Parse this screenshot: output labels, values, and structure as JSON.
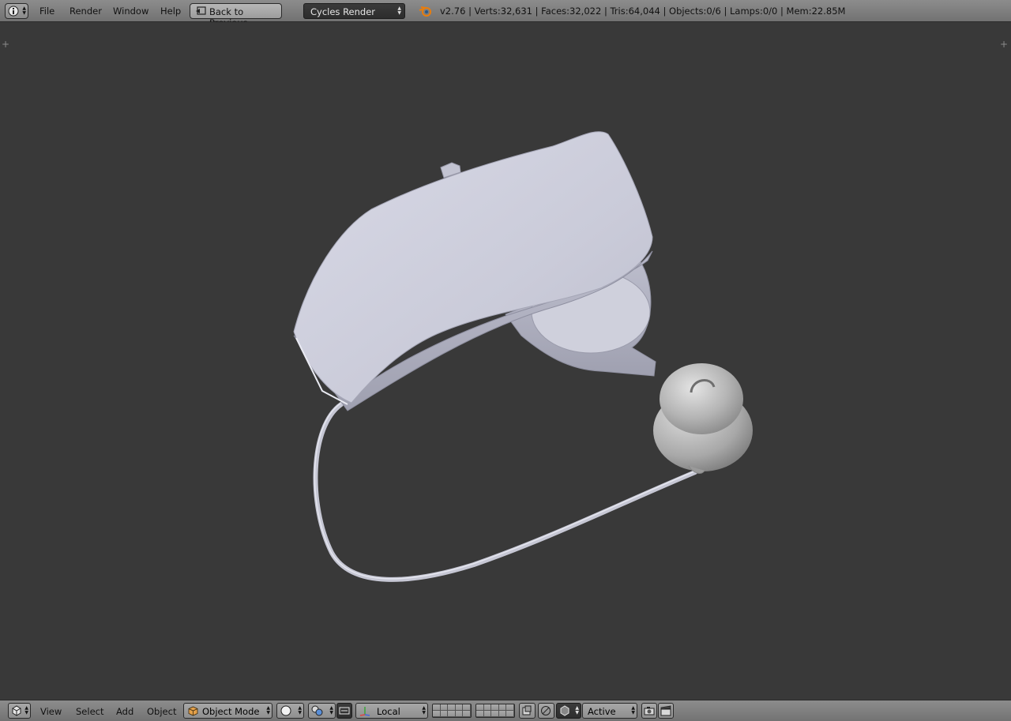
{
  "top_header": {
    "editor_type_icon": "info-icon",
    "menus": [
      "File",
      "Render",
      "Window",
      "Help"
    ],
    "back_button_label": "Back to Previous",
    "back_button_icon": "screen-back-icon",
    "render_engine": "Cycles Render",
    "logo_icon": "blender-logo-icon",
    "stats": "v2.76 | Verts:32,631 | Faces:32,022 | Tris:64,044 | Objects:0/6 | Lamps:0/0 | Mem:22.85M"
  },
  "viewport": {
    "background": "#393939",
    "model_color": "#c9cad8",
    "earbud_color": "#b5b5b5"
  },
  "bottom_header": {
    "editor_type_icon": "3d-view-icon",
    "menus": [
      "View",
      "Select",
      "Add",
      "Object"
    ],
    "mode": "Object Mode",
    "mode_icon": "cube-icon",
    "shading_icon": "solid-sphere-icon",
    "pivot_icon": "pivot-icon",
    "manipulator_icon": "manipulator-icon",
    "orientation_icon": "transform-axes-icon",
    "orientation": "Local",
    "layers_icon": "layers-icon",
    "snap_icon": "snap-icon",
    "proportional_icon": "proportional-icon",
    "snap_target": "Active",
    "render_icon": "camera-render-icon",
    "anim_render_icon": "clapper-icon"
  }
}
